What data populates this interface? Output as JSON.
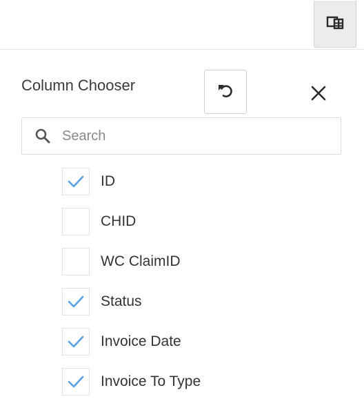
{
  "toolbar": {
    "column_chooser_icon": "column-chooser-icon"
  },
  "panel": {
    "title": "Column Chooser",
    "reset_icon": "undo-icon",
    "close_icon": "close-icon",
    "search": {
      "placeholder": "Search",
      "value": "",
      "icon": "search-icon"
    },
    "columns": [
      {
        "label": "ID",
        "checked": true
      },
      {
        "label": "CHID",
        "checked": false
      },
      {
        "label": "WC ClaimID",
        "checked": false
      },
      {
        "label": "Status",
        "checked": true
      },
      {
        "label": "Invoice Date",
        "checked": true
      },
      {
        "label": "Invoice To Type",
        "checked": true
      }
    ]
  },
  "colors": {
    "check": "#5aa0e6",
    "toolbar_button_bg": "#ececec"
  }
}
